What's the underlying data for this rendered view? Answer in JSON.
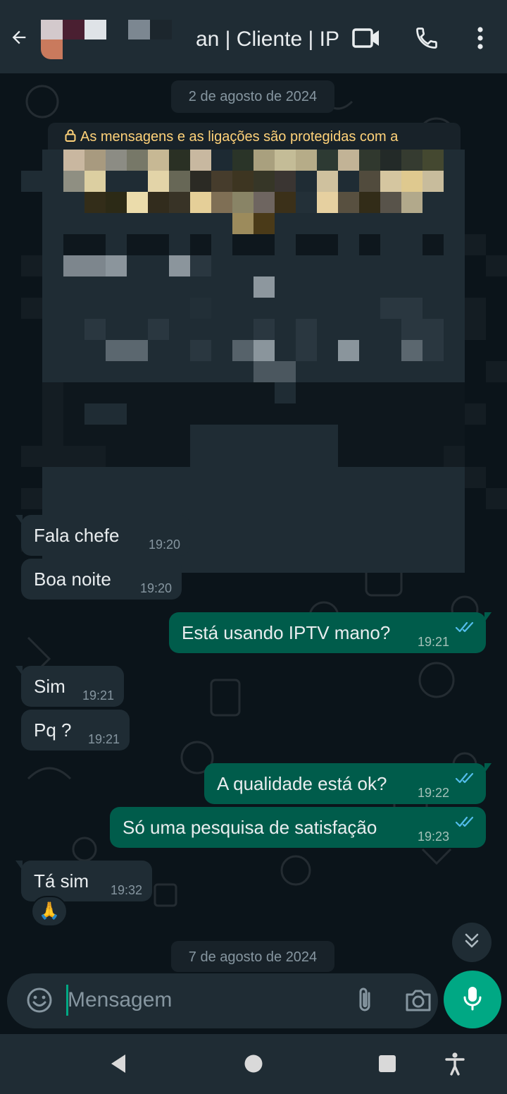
{
  "header": {
    "contact_name": "an | Cliente | IP",
    "icons": [
      "back-arrow-icon",
      "video-call-icon",
      "voice-call-icon",
      "more-options-icon"
    ]
  },
  "chat": {
    "date_chips": [
      "2 de agosto de 2024",
      "7 de agosto de 2024"
    ],
    "encryption_notice": "As mensagens e as ligações são protegidas com a",
    "messages": [
      {
        "direction": "in",
        "text": "Fala chefe",
        "time": "19:20"
      },
      {
        "direction": "in",
        "text": "Boa noite",
        "time": "19:20"
      },
      {
        "direction": "out",
        "text": "Está usando IPTV mano?",
        "time": "19:21",
        "status": "read"
      },
      {
        "direction": "in",
        "text": "Sim",
        "time": "19:21"
      },
      {
        "direction": "in",
        "text": "Pq ?",
        "time": "19:21"
      },
      {
        "direction": "out",
        "text": "A qualidade está ok?",
        "time": "19:22",
        "status": "read"
      },
      {
        "direction": "out",
        "text": "Só uma pesquisa de satisfação",
        "time": "19:23",
        "status": "read"
      },
      {
        "direction": "in",
        "text": "Tá sim",
        "time": "19:32"
      }
    ],
    "reaction": "🙏"
  },
  "composer": {
    "placeholder": "Mensagem",
    "icons": [
      "emoji-icon",
      "attach-icon",
      "camera-icon",
      "microphone-icon"
    ]
  },
  "colors": {
    "header_bg": "#1f2c34",
    "chat_bg": "#0b141a",
    "incoming_bubble": "#1f2c34",
    "outgoing_bubble": "#005c4b",
    "accent": "#00a884",
    "read_ticks": "#53bdeb",
    "notice_text": "#ffd279"
  }
}
